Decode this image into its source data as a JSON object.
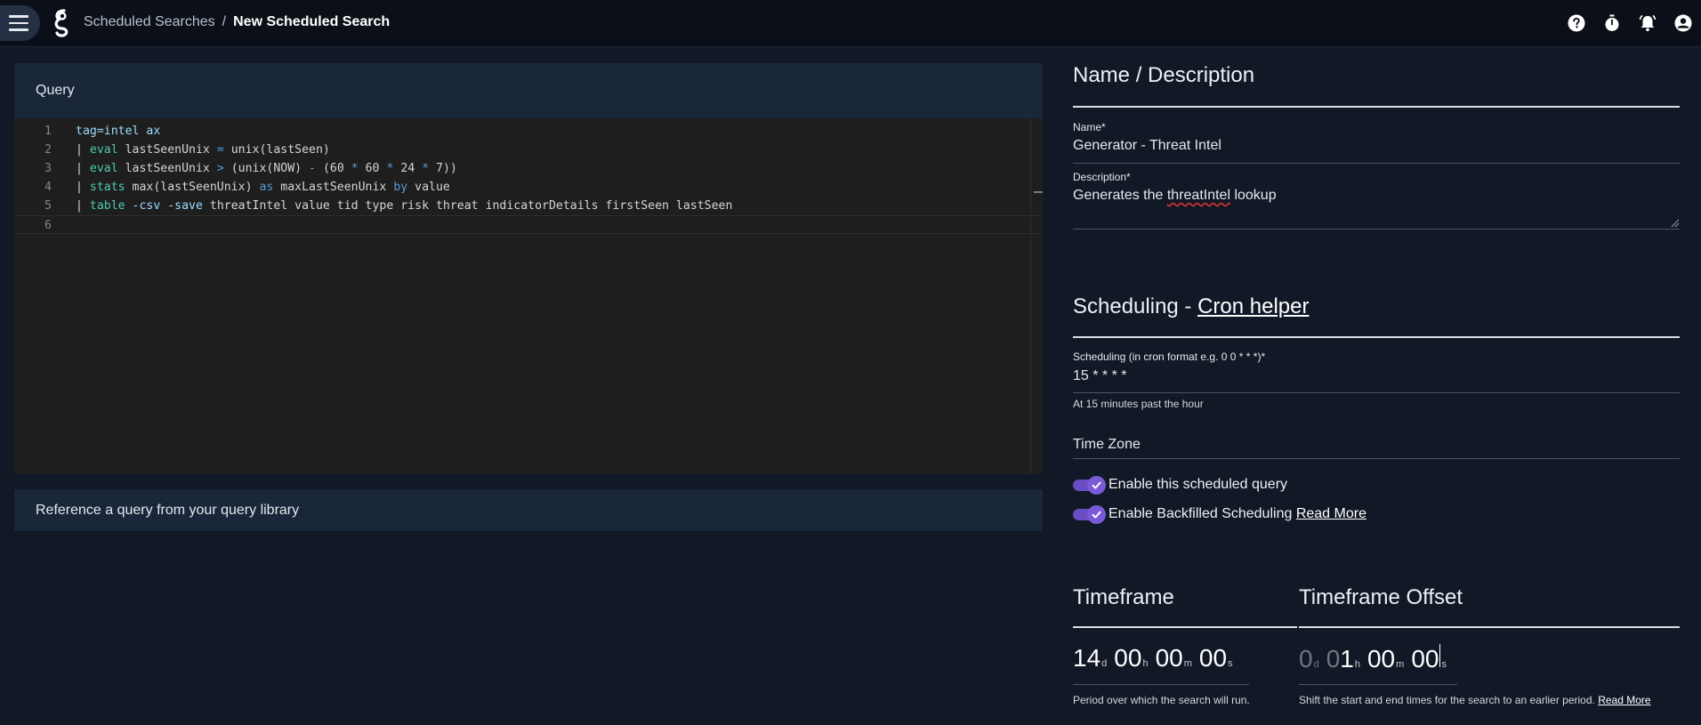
{
  "breadcrumb": {
    "parent": "Scheduled Searches",
    "separator": "/",
    "current": "New Scheduled Search"
  },
  "query": {
    "header": "Query",
    "line_numbers": [
      "1",
      "2",
      "3",
      "4",
      "5",
      "6"
    ],
    "lines": [
      [
        {
          "t": "tag=intel ax",
          "c": "lb"
        }
      ],
      [
        {
          "t": "| ",
          "c": ""
        },
        {
          "t": "eval",
          "c": "kw"
        },
        {
          "t": " lastSeenUnix ",
          "c": ""
        },
        {
          "t": "=",
          "c": "blue"
        },
        {
          "t": " unix(lastSeen)",
          "c": ""
        }
      ],
      [
        {
          "t": "| ",
          "c": ""
        },
        {
          "t": "eval",
          "c": "kw"
        },
        {
          "t": " lastSeenUnix ",
          "c": ""
        },
        {
          "t": ">",
          "c": "blue"
        },
        {
          "t": " (unix(NOW) ",
          "c": ""
        },
        {
          "t": "-",
          "c": "blue"
        },
        {
          "t": " (60 ",
          "c": ""
        },
        {
          "t": "*",
          "c": "blue"
        },
        {
          "t": " 60 ",
          "c": ""
        },
        {
          "t": "*",
          "c": "blue"
        },
        {
          "t": " 24 ",
          "c": ""
        },
        {
          "t": "*",
          "c": "blue"
        },
        {
          "t": " 7))",
          "c": ""
        }
      ],
      [
        {
          "t": "| ",
          "c": ""
        },
        {
          "t": "stats",
          "c": "kw"
        },
        {
          "t": " max(lastSeenUnix) ",
          "c": ""
        },
        {
          "t": "as",
          "c": "blue"
        },
        {
          "t": " maxLastSeenUnix ",
          "c": ""
        },
        {
          "t": "by",
          "c": "blue"
        },
        {
          "t": " value",
          "c": ""
        }
      ],
      [
        {
          "t": "| ",
          "c": ""
        },
        {
          "t": "table",
          "c": "kw"
        },
        {
          "t": " -csv -save",
          "c": "lb"
        },
        {
          "t": " threatIntel value tid type risk threat indicatorDetails firstSeen lastSeen",
          "c": ""
        }
      ],
      []
    ]
  },
  "reference_card": {
    "label": "Reference a query from your query library"
  },
  "name_description": {
    "title": "Name / Description",
    "name_label": "Name*",
    "name_value": "Generator - Threat Intel",
    "description_label": "Description*",
    "description_before": "Generates the ",
    "description_misspelled": "threatIntel",
    "description_after": " lookup"
  },
  "scheduling": {
    "title_prefix": "Scheduling - ",
    "title_link": "Cron helper",
    "cron_label": "Scheduling (in cron format e.g. 0 0 * * *)*",
    "cron_value": "15 * * * *",
    "cron_helper": "At 15 minutes past the hour",
    "timezone_label": "Time Zone",
    "enable_label": "Enable this scheduled query",
    "enable_on": true,
    "backfill_label": "Enable Backfilled Scheduling",
    "backfill_on": true,
    "backfill_link": "Read More"
  },
  "timeframe": {
    "title": "Timeframe",
    "days": "14",
    "days_unit": "d",
    "hours": "00",
    "hours_unit": "h",
    "minutes": "00",
    "minutes_unit": "m",
    "seconds": "00",
    "seconds_unit": "s",
    "helper": "Period over which the search will run."
  },
  "offset": {
    "title": "Timeframe Offset",
    "days": "0",
    "days_unit": "d",
    "hours_dim": "0",
    "hours": "1",
    "hours_unit": "h",
    "minutes": "00",
    "minutes_unit": "m",
    "seconds": "00",
    "seconds_unit": "s",
    "helper": "Shift the start and end times for the search to an earlier period.",
    "helper_link": "Read More"
  },
  "icons": [
    "menu-icon",
    "gravwell-logo-icon",
    "help-icon",
    "timer-icon",
    "bell-icon",
    "account-icon",
    "check-icon",
    "resize-handle-icon"
  ],
  "colors": {
    "accent": "#6a4dc4",
    "background": "#111927",
    "card": "#1a263a",
    "editor": "#1e1e1e",
    "keyword": "#4ec9b0",
    "operator": "#569cd6"
  }
}
